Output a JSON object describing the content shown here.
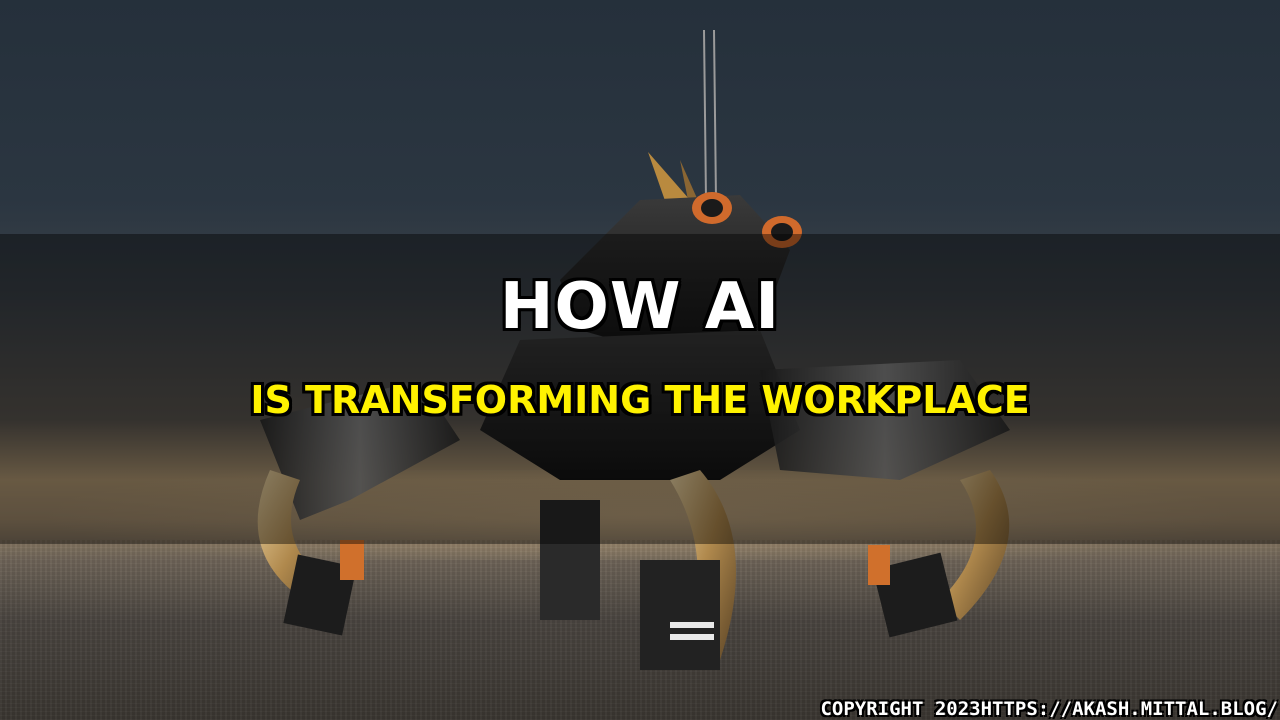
{
  "title": {
    "line1": "HOW AI",
    "line2": "IS TRANSFORMING THE WORKPLACE"
  },
  "footer": {
    "copyright": "COPYRIGHT 2023HTTPS://AKASH.MITTAL.BLOG/"
  },
  "colors": {
    "title_primary": "#ffffff",
    "title_secondary": "#fff200",
    "text_outline": "#000000"
  }
}
